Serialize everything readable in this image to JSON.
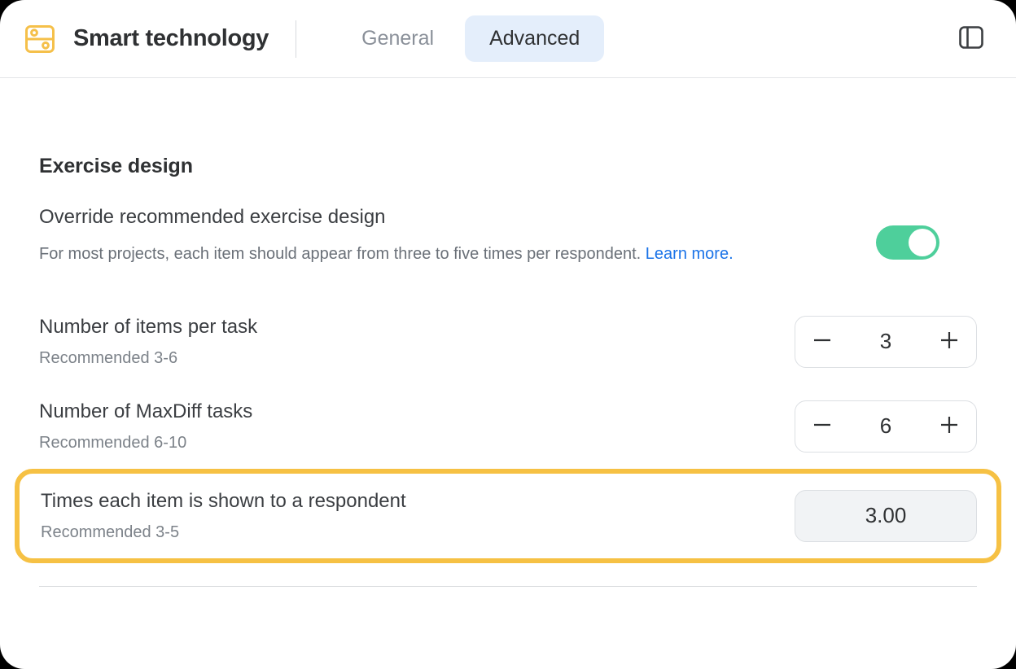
{
  "header": {
    "brand_icon": "server-icon",
    "brand_title": "Smart technology",
    "tabs": [
      {
        "label": "General",
        "active": false
      },
      {
        "label": "Advanced",
        "active": true
      }
    ],
    "panel_toggle_icon": "sidebar-panel-icon"
  },
  "main": {
    "section_title": "Exercise design",
    "override": {
      "title": "Override recommended exercise design",
      "description": "For most projects, each item should appear from three to five times per respondent. ",
      "link_text": "Learn more.",
      "toggle_state": "on"
    },
    "settings": [
      {
        "label": "Number of items per task",
        "sub": "Recommended 3-6",
        "control": "stepper",
        "value": "3",
        "minus": "—",
        "plus": "+"
      },
      {
        "label": "Number of MaxDiff tasks",
        "sub": "Recommended 6-10",
        "control": "stepper",
        "value": "6",
        "minus": "—",
        "plus": "+"
      },
      {
        "label": "Times each item is shown to a respondent",
        "sub": "Recommended 3-5",
        "control": "readonly",
        "value": "3.00",
        "highlighted": true
      }
    ]
  },
  "colors": {
    "brand_yellow": "#f6c144",
    "toggle_green": "#4ecf9b",
    "tab_active_bg": "#e4eefb",
    "link_blue": "#1a73e8",
    "highlight_border": "#f6c144"
  }
}
